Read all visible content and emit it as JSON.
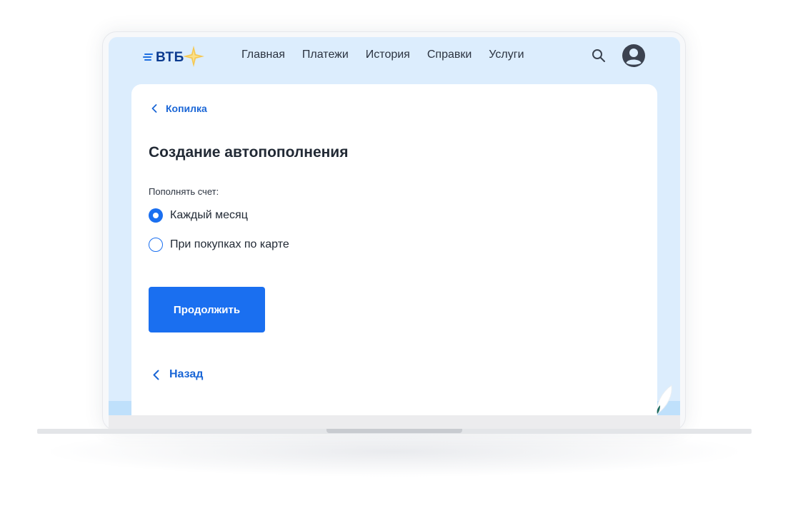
{
  "header": {
    "logo_text": "ВТБ",
    "nav": [
      {
        "label": "Главная"
      },
      {
        "label": "Платежи"
      },
      {
        "label": "История"
      },
      {
        "label": "Справки"
      },
      {
        "label": "Услуги"
      }
    ],
    "search_icon": "search-icon",
    "avatar_icon": "user-avatar-icon"
  },
  "breadcrumb": {
    "label": "Копилка",
    "icon": "chevron-left-icon"
  },
  "page": {
    "title": "Создание автопополнения",
    "field_label": "Пополнять счет:"
  },
  "options": [
    {
      "label": "Каждый месяц",
      "selected": true
    },
    {
      "label": "При покупках по карте",
      "selected": false
    }
  ],
  "actions": {
    "continue_label": "Продолжить",
    "back_label": "Назад"
  },
  "colors": {
    "accent": "#1a6ff0",
    "link": "#1a66d6",
    "screen_background": "#dcedfd",
    "logo_blue": "#0b3a8f",
    "logo_star": "#f6c64a"
  }
}
